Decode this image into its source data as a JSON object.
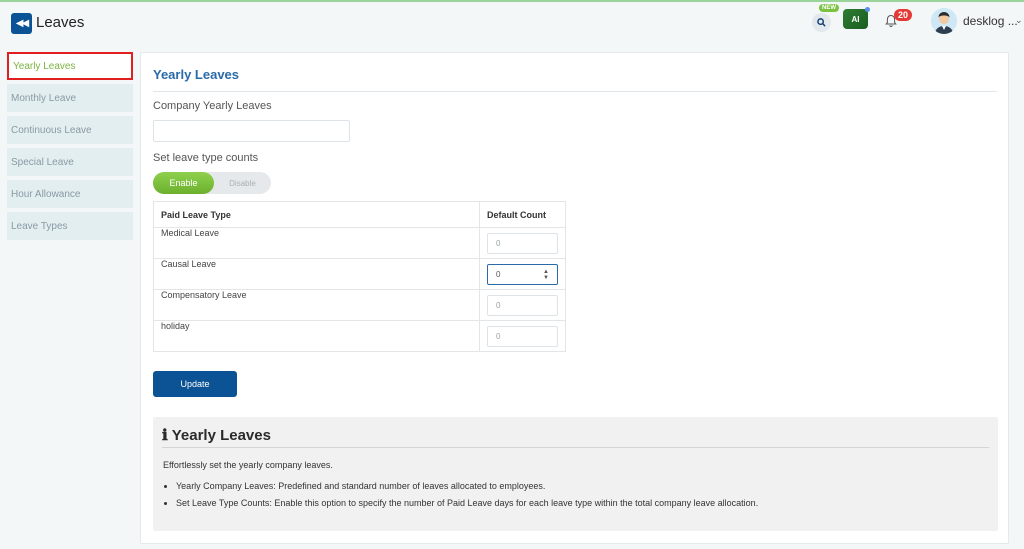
{
  "header": {
    "back_icon": "double-chevron-left-icon",
    "title": "Leaves",
    "new_badge": "NEW",
    "ai_label": "AI",
    "notification_count": "20",
    "user_name": "desklog ...",
    "accent_color": "#0b5394"
  },
  "sidebar": {
    "items": [
      {
        "label": "Yearly Leaves",
        "active": true
      },
      {
        "label": "Monthly Leave"
      },
      {
        "label": "Continuous Leave"
      },
      {
        "label": "Special Leave"
      },
      {
        "label": "Hour Allowance"
      },
      {
        "label": "Leave Types"
      }
    ]
  },
  "main": {
    "title": "Yearly Leaves",
    "company_label": "Company Yearly Leaves",
    "company_value": "",
    "set_label": "Set leave type counts",
    "toggle": {
      "enable": "Enable",
      "disable": "Disable",
      "selected": "Enable"
    },
    "table": {
      "headers": [
        "Paid Leave Type",
        "Default Count"
      ],
      "rows": [
        {
          "name": "Medical Leave",
          "count": "0"
        },
        {
          "name": "Causal Leave",
          "count": "0"
        },
        {
          "name": "Compensatory Leave",
          "count": "0"
        },
        {
          "name": "holiday",
          "count": "0"
        }
      ]
    },
    "update_button": "Update"
  },
  "info": {
    "title": "Yearly Leaves",
    "description": "Effortlessly set the yearly company leaves.",
    "items": [
      "Yearly Company Leaves: Predefined and standard number of leaves allocated to employees.",
      "Set Leave Type Counts: Enable this option to specify the number of Paid Leave days for each leave type within the total company leave allocation."
    ]
  }
}
